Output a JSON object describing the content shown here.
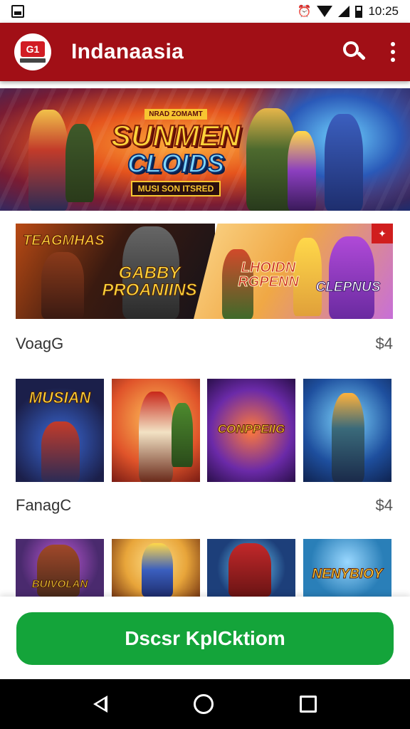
{
  "status_bar": {
    "time": "10:25"
  },
  "app_bar": {
    "title": "Indanaasia",
    "logo_text": "G1"
  },
  "hero_banner": {
    "kicker": "NRAD ZOMAMT",
    "title_line1": "SUNMEN",
    "title_line2": "CLOIDS",
    "tagline": "MUSI SON ITSRED"
  },
  "featured_banner": {
    "left_top": "TEAGMHAS",
    "left_title": "GABBY PROANIINS",
    "right_title": "LHOIDN RGPENN",
    "right_subtitle": "CLEPNUS"
  },
  "section1": {
    "label": "VoagG",
    "count": "$4"
  },
  "tiles_row1": [
    {
      "label": "MUSIAN",
      "bg": "#1b1f4a"
    },
    {
      "label": "",
      "bg": "#e0542a"
    },
    {
      "label": "CONPPEIIG",
      "bg": "#6b2aa8"
    },
    {
      "label": "",
      "bg": "#1e4f9e"
    }
  ],
  "section2": {
    "label": "FanagC",
    "count": "$4"
  },
  "tiles_row2": [
    {
      "label": "BUIVOLAN",
      "bg": "#4a2a6e"
    },
    {
      "label": "",
      "bg": "#e8a53a"
    },
    {
      "label": "",
      "bg": "#1d3f7a"
    },
    {
      "label": "NENYBIOY",
      "bg": "#2a7fb8"
    }
  ],
  "cta": {
    "label": "Dscsr KplCktiom",
    "color": "#14a43a"
  },
  "colors": {
    "app_bar": "#a10f16",
    "accent": "#14a43a"
  }
}
